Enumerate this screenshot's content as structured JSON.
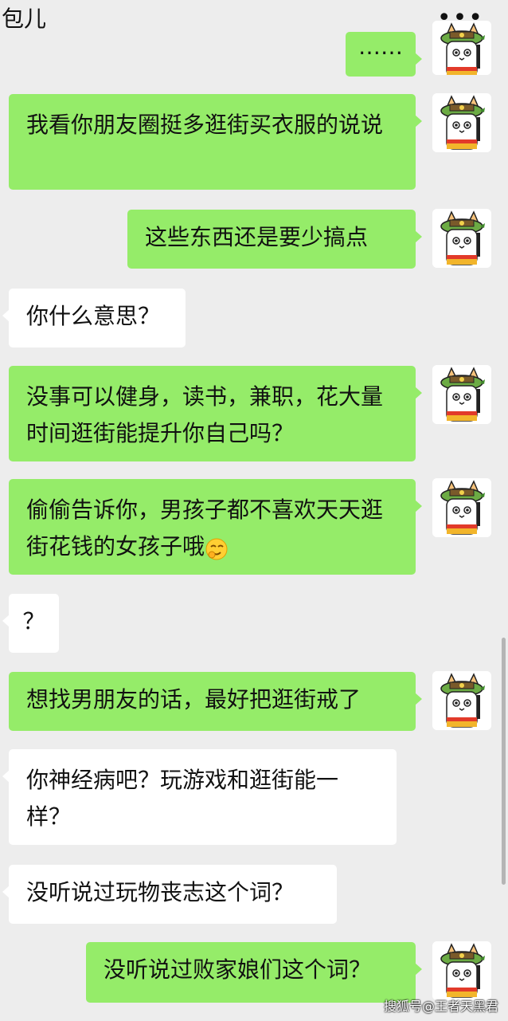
{
  "header": {
    "title": "包儿",
    "more_label": "•••"
  },
  "messages": [
    {
      "from": "me",
      "text": "……"
    },
    {
      "from": "me",
      "text": "我看你朋友圈挺多逛街买衣服的说说"
    },
    {
      "from": "me",
      "text": "这些东西还是要少搞点"
    },
    {
      "from": "them",
      "text": "你什么意思？"
    },
    {
      "from": "me",
      "text": "没事可以健身，读书，兼职，花大量时间逛街能提升你自己吗？"
    },
    {
      "from": "me",
      "text": "偷偷告诉你，男孩子都不喜欢天天逛街花钱的女孩子哦",
      "emoji": "shy-laugh-emoji"
    },
    {
      "from": "them",
      "text": "？"
    },
    {
      "from": "me",
      "text": "想找男朋友的话，最好把逛街戒了"
    },
    {
      "from": "them",
      "text": "你神经病吧？玩游戏和逛街能一样？"
    },
    {
      "from": "them",
      "text": "没听说过玩物丧志这个词？"
    },
    {
      "from": "me",
      "text": "没听说过败家娘们这个词？"
    }
  ],
  "watermark": "搜狐号@王者天黑君",
  "colors": {
    "my_bubble": "#95ec69",
    "their_bubble": "#ffffff",
    "background": "#ededed"
  }
}
